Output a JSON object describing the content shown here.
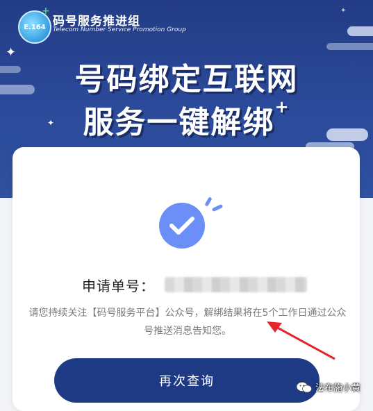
{
  "header": {
    "logo_text": "E.164",
    "org_name": "码号服务推进组",
    "org_name_en": "Telecom Number Service  Promotion Group",
    "headline_line1": "号码绑定互联网",
    "headline_line2": "服务一键解绑",
    "headline_plus": "+"
  },
  "result": {
    "order_label": "申请单号：",
    "notice": "请您持续关注【码号服务平台】公众号，解绑结果将在5个工作日通过公众号推送消息告知您。",
    "requery_label": "再次查询"
  },
  "watermark": {
    "text": "法布施小黄"
  },
  "colors": {
    "banner": "#233c86",
    "check_circle": "#6c8ff7",
    "button": "#1e3a85",
    "arrow": "#e8242b"
  }
}
